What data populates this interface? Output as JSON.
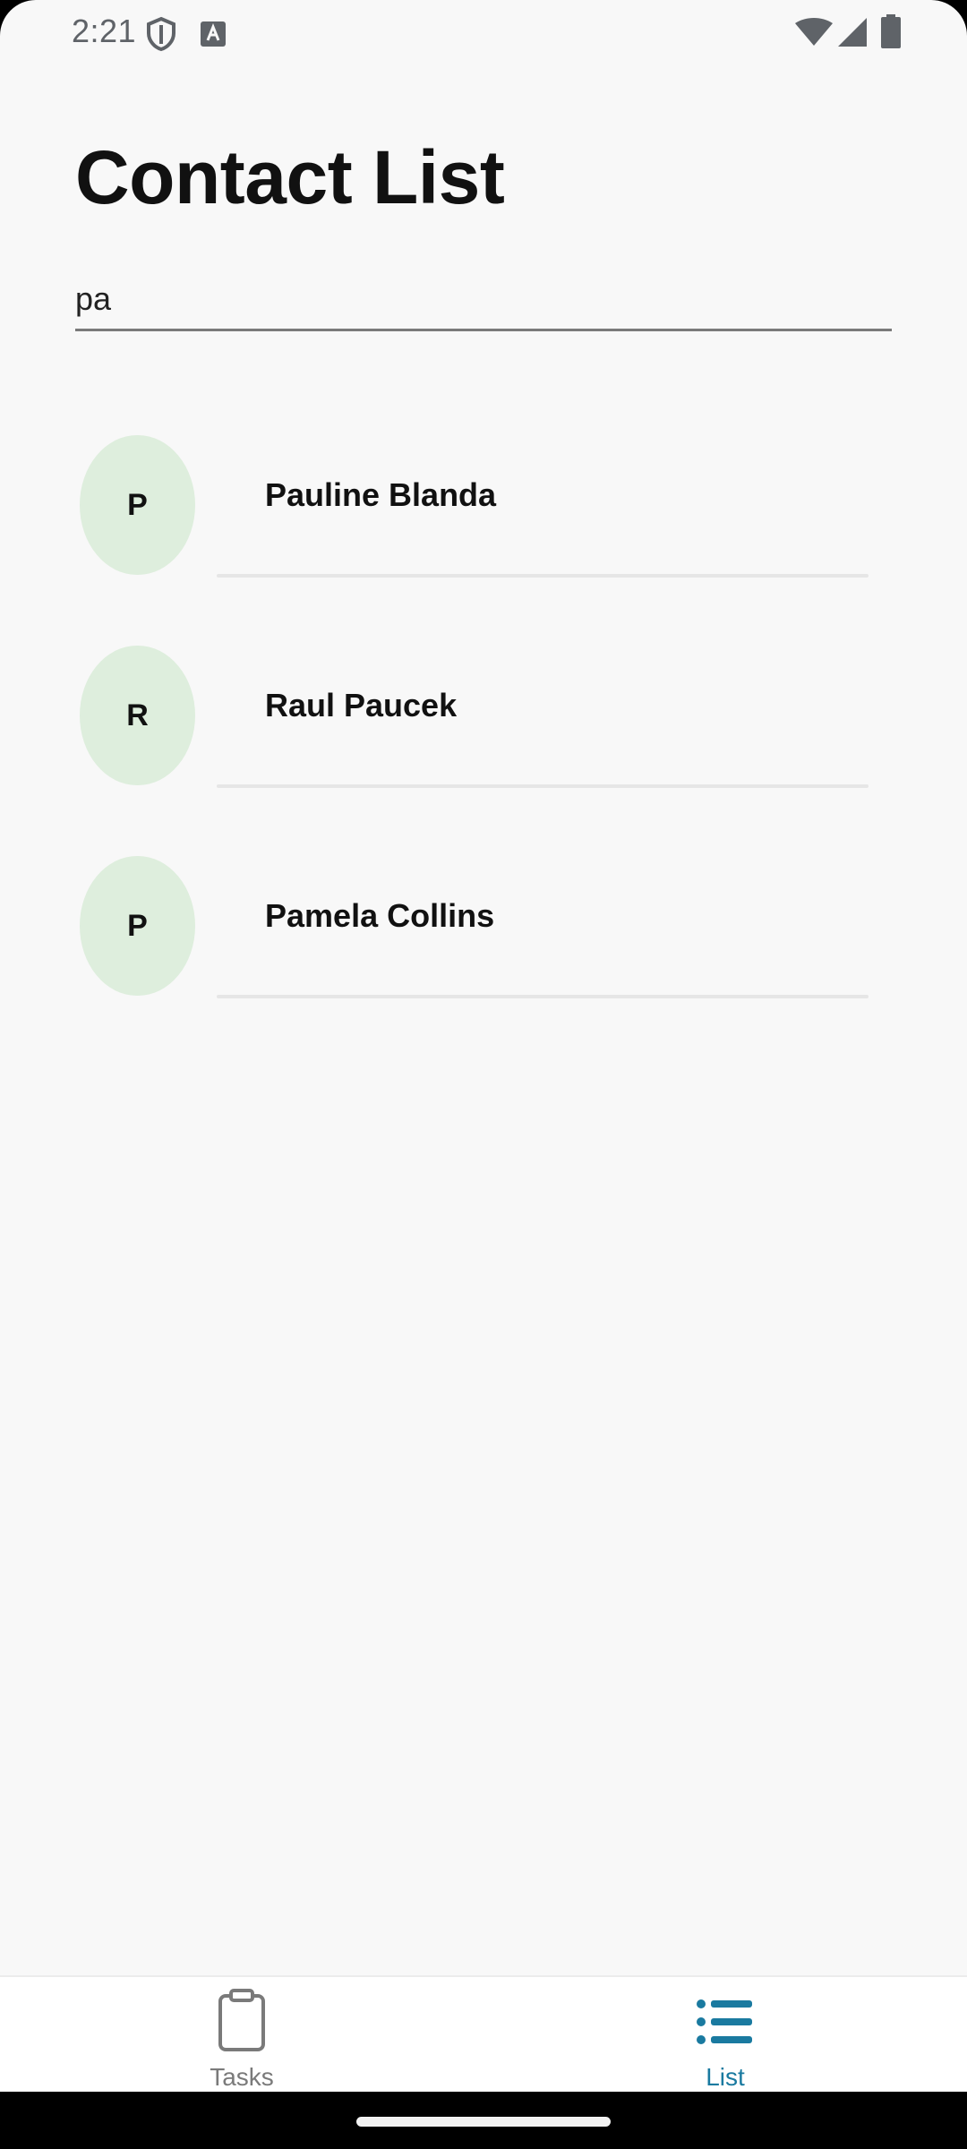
{
  "status_bar": {
    "time": "2:21",
    "icons": [
      "shield-icon",
      "text-a-icon",
      "wifi-icon",
      "cell-signal-icon",
      "battery-icon"
    ]
  },
  "page": {
    "title": "Contact List"
  },
  "search": {
    "value": "pa",
    "placeholder": ""
  },
  "contacts": [
    {
      "initial": "P",
      "name": "Pauline Blanda"
    },
    {
      "initial": "R",
      "name": "Raul Paucek"
    },
    {
      "initial": "P",
      "name": "Pamela Collins"
    }
  ],
  "bottom_nav": {
    "items": [
      {
        "label": "Tasks",
        "icon": "clipboard-icon",
        "active": false
      },
      {
        "label": "List",
        "icon": "list-icon",
        "active": true
      }
    ]
  },
  "colors": {
    "background": "#f8f8f8",
    "avatar_bg": "#deeedd",
    "active_nav": "#1a7aa0",
    "inactive_nav": "#7a7a7a",
    "divider": "#e6e6e6"
  }
}
